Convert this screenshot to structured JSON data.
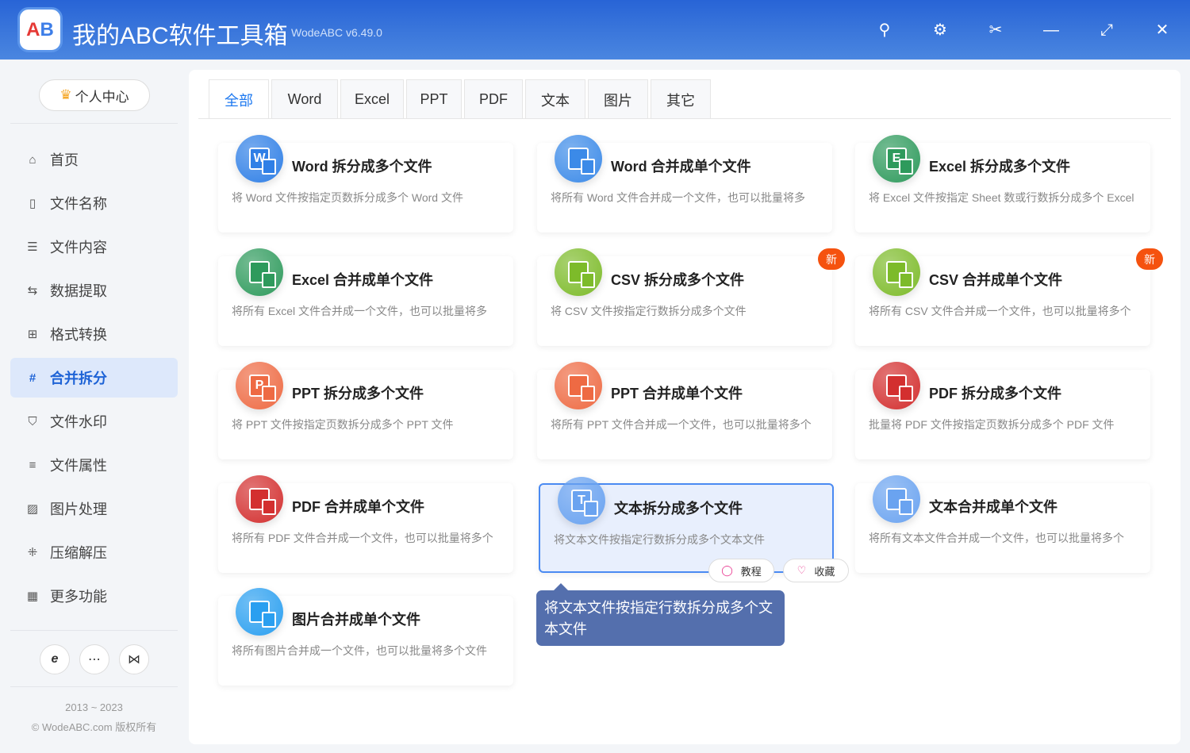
{
  "header": {
    "logo_text": "AB",
    "title": "我的ABC软件工具箱",
    "version": "WodeABC v6.49.0"
  },
  "sidebar": {
    "profile": "个人中心",
    "items": [
      {
        "label": "首页",
        "icon": "home-icon"
      },
      {
        "label": "文件名称",
        "icon": "file-name-icon"
      },
      {
        "label": "文件内容",
        "icon": "content-icon"
      },
      {
        "label": "数据提取",
        "icon": "extract-icon"
      },
      {
        "label": "格式转换",
        "icon": "convert-icon"
      },
      {
        "label": "合并拆分",
        "icon": "hash-icon"
      },
      {
        "label": "文件水印",
        "icon": "shield-icon"
      },
      {
        "label": "文件属性",
        "icon": "list-icon"
      },
      {
        "label": "图片处理",
        "icon": "image-icon"
      },
      {
        "label": "压缩解压",
        "icon": "compress-icon"
      },
      {
        "label": "更多功能",
        "icon": "grid-icon"
      }
    ],
    "active": "合并拆分",
    "years": "2013 ~ 2023",
    "copyright": "© WodeABC.com 版权所有"
  },
  "tabs": [
    "全部",
    "Word",
    "Excel",
    "PPT",
    "PDF",
    "文本",
    "图片",
    "其它"
  ],
  "cards": [
    {
      "title": "Word 拆分成多个文件",
      "desc": "将 Word 文件按指定页数拆分成多个 Word 文件",
      "glyph": "W",
      "color": "#2f7fe6"
    },
    {
      "title": "Word 合并成单个文件",
      "desc": "将所有 Word 文件合并成一个文件，也可以批量将多",
      "glyph": "",
      "color": "#3b8ae8"
    },
    {
      "title": "Excel 拆分成多个文件",
      "desc": "将 Excel 文件按指定 Sheet 数或行数拆分成多个 Excel",
      "glyph": "E",
      "color": "#2e9a5c"
    },
    {
      "title": "Excel 合并成单个文件",
      "desc": "将所有 Excel 文件合并成一个文件，也可以批量将多",
      "glyph": "",
      "color": "#2e9a5c"
    },
    {
      "title": "CSV 拆分成多个文件",
      "desc": "将 CSV 文件按指定行数拆分成多个文件",
      "glyph": "",
      "color": "#7dbb2a",
      "badge": "新"
    },
    {
      "title": "CSV 合并成单个文件",
      "desc": "将所有 CSV 文件合并成一个文件，也可以批量将多个",
      "glyph": "",
      "color": "#7dbb2a",
      "badge": "新"
    },
    {
      "title": "PPT 拆分成多个文件",
      "desc": "将 PPT 文件按指定页数拆分成多个 PPT 文件",
      "glyph": "P",
      "color": "#ee6a43"
    },
    {
      "title": "PPT 合并成单个文件",
      "desc": "将所有 PPT 文件合并成一个文件，也可以批量将多个",
      "glyph": "",
      "color": "#ee6a43"
    },
    {
      "title": "PDF 拆分成多个文件",
      "desc": "批量将 PDF 文件按指定页数拆分成多个 PDF 文件",
      "glyph": "",
      "color": "#d32f2f"
    },
    {
      "title": "PDF 合并成单个文件",
      "desc": "将所有 PDF 文件合并成一个文件，也可以批量将多个",
      "glyph": "",
      "color": "#d32f2f"
    },
    {
      "title": "文本拆分成多个文件",
      "desc": "将文本文件按指定行数拆分成多个文本文件",
      "glyph": "T",
      "color": "#6aa3f0"
    },
    {
      "title": "文本合并成单个文件",
      "desc": "将所有文本文件合并成一个文件，也可以批量将多个",
      "glyph": "",
      "color": "#6aa3f0"
    },
    {
      "title": "图片合并成单个文件",
      "desc": "将所有图片合并成一个文件，也可以批量将多个文件",
      "glyph": "",
      "color": "#2a9ff0"
    }
  ],
  "actions": {
    "tutorial": "教程",
    "favorite": "收藏"
  },
  "tooltip": "将文本文件按指定行数拆分成多个文本文件"
}
